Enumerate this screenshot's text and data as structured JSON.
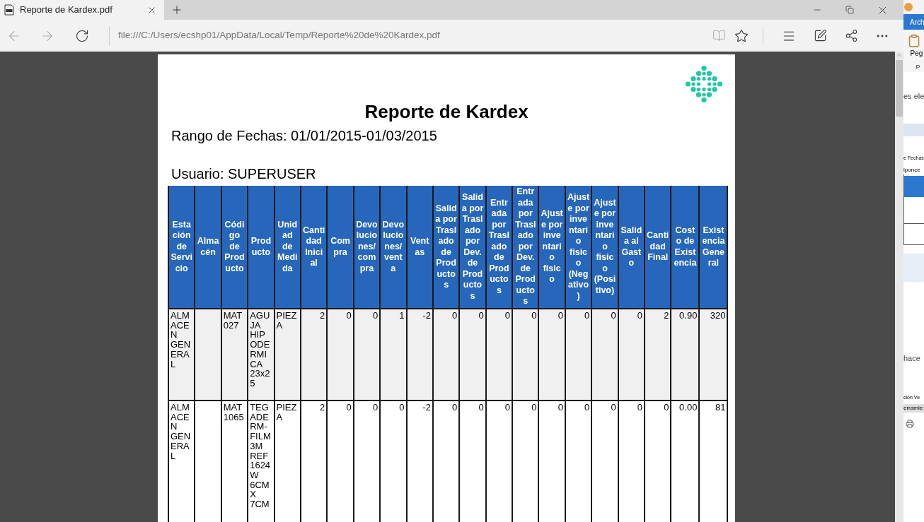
{
  "browser": {
    "tab": {
      "title": "Reporte de Kardex.pdf"
    },
    "address_bar": {
      "url": "file:///C:/Users/ecshp01/AppData/Local/Temp/Reporte%20de%20Kardex.pdf"
    }
  },
  "document": {
    "title": "Reporte de Kardex",
    "date_range": "Rango de Fechas: 01/01/2015-01/03/2015",
    "user": "Usuario: SUPERUSER",
    "table": {
      "columns": [
        "Estación de Servicio",
        "Almacén",
        "Código de Producto",
        "Producto",
        "Unidad de Medida",
        "Cantidad Inicial",
        "Compra",
        "Devoluciones/compra",
        "Devoluciones/venta",
        "Ventas",
        "Salida por Traslado de Productos",
        "Salida por Traslado por Dev. de Productos",
        "Entrada por Traslado de Productos",
        "Entrada por Traslado por Dev. de Productos",
        "Ajuste por inventario fisico",
        "Ajuste por inventario fisico (Negativo)",
        "Ajuste por inventario fisico (Positivo)",
        "Salida al Gasto",
        "Cantidad Final",
        "Costo de Existencia",
        "Existencia General"
      ],
      "rows": [
        {
          "cells": [
            "ALMACEN GENERAL",
            "",
            "MAT027",
            "AGUJA HIPODERMICA 23x25",
            "PIEZA",
            "2",
            "0",
            "0",
            "1",
            "-2",
            "0",
            "0",
            "0",
            "0",
            "0",
            "0",
            "0",
            "0",
            "2",
            "0.90",
            "320"
          ]
        },
        {
          "cells": [
            "ALMACEN GENERAL",
            "",
            "MAT1065",
            "TEGADERM-FILM 3M REF 1624W 6CM X 7CM",
            "PIEZA",
            "2",
            "0",
            "0",
            "0",
            "-2",
            "0",
            "0",
            "0",
            "0",
            "0",
            "0",
            "0",
            "0",
            "0",
            "0.00",
            "81"
          ]
        }
      ]
    }
  },
  "background_window": {
    "ribbon_tab": "Arch",
    "paste_label": "Peg",
    "group_label": "P",
    "texts": [
      "es ele",
      "e Fechas",
      "lponce",
      "hace",
      "ción",
      "Ve",
      "erramie"
    ]
  }
}
